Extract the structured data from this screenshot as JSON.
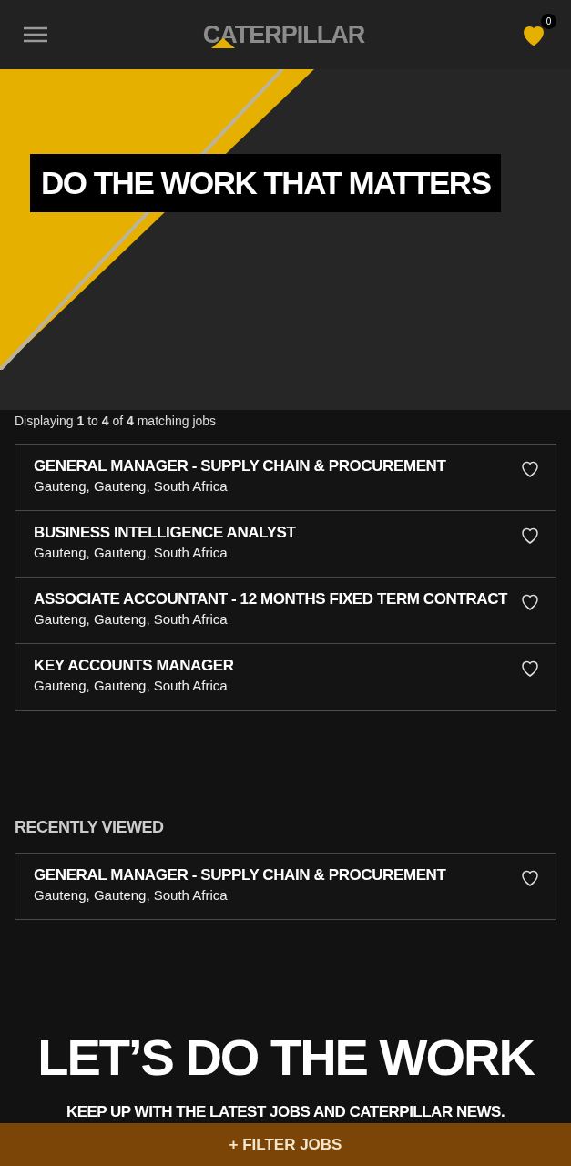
{
  "header": {
    "logo": "CATERPILLAR",
    "favorites_count": "0"
  },
  "hero": {
    "kind": "picture",
    "headline": "DO THE WORK THAT MATTERS"
  },
  "results": {
    "summary": "Displaying **1** to **4** of **4** matching jobs",
    "jobs": [
      {
        "title": "GENERAL MANAGER - SUPPLY CHAIN & PROCUREMENT",
        "location": "Gauteng, Gauteng, South Africa",
        "favorited": false
      },
      {
        "title": "BUSINESS INTELLIGENCE ANALYST",
        "location": "Gauteng, Gauteng, South Africa",
        "favorited": false
      },
      {
        "title": "ASSOCIATE ACCOUNTANT - 12 MONTHS FIXED TERM CONTRACT",
        "location": "Gauteng, Gauteng, South Africa",
        "favorited": false
      },
      {
        "title": "KEY ACCOUNTS MANAGER",
        "location": "Gauteng, Gauteng, South Africa",
        "favorited": false
      }
    ]
  },
  "recently_viewed": {
    "heading": "RECENTLY VIEWED",
    "jobs": [
      {
        "title": "GENERAL MANAGER - SUPPLY CHAIN & PROCUREMENT",
        "location": "Gauteng, Gauteng, South Africa",
        "favorited": false
      }
    ]
  },
  "promo": {
    "heading": "LET’S DO THE WORK",
    "subheading": "KEEP UP WITH THE LATEST JOBS AND CATERPILLAR NEWS."
  },
  "filter_button": "+ FILTER JOBS"
}
